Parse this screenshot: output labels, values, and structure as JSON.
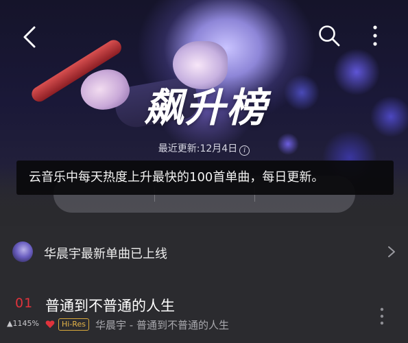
{
  "header": {
    "title": "飙升榜",
    "update_text": "最近更新:12月4日",
    "icons": [
      "back-icon",
      "search-icon",
      "more-icon",
      "info-icon"
    ]
  },
  "tooltip": {
    "text": "云音乐中每天热度上升最快的100首单曲，每日更新。"
  },
  "promo": {
    "text": "华晨宇最新单曲已上线",
    "icon": "chevron-right-icon"
  },
  "songs": [
    {
      "rank": "01",
      "trend": "▲1145%",
      "title": "普通到不普通的人生",
      "badge": "Hi-Res",
      "subtitle": "华晨宇 - 普通到不普通的人生",
      "liked": true
    }
  ],
  "colors": {
    "accent_red": "#e0333c",
    "hires_gold": "#e6b548",
    "background": "#2a2a2e"
  }
}
